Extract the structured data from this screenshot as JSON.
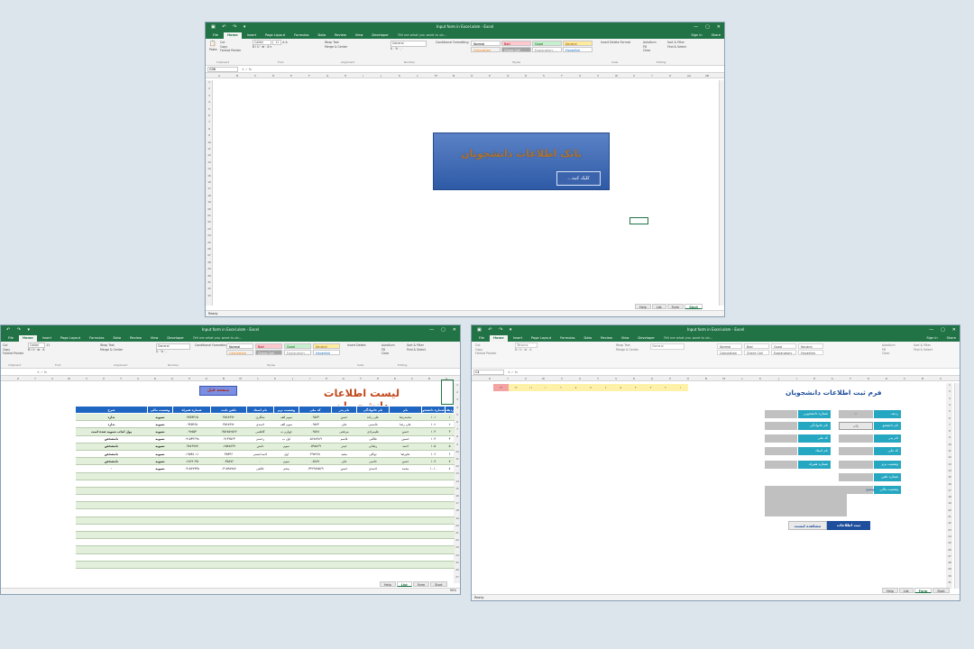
{
  "windows": {
    "main": {
      "title": "Input form in Excel.xlsm - Excel",
      "tabs": [
        "File",
        "Home",
        "Insert",
        "Page Layout",
        "Formulas",
        "Data",
        "Review",
        "View",
        "Developer"
      ],
      "tell": "Tell me what you want to do...",
      "signin": "Sign in",
      "share": "Share",
      "namebox": "G36",
      "sheets": [
        "Help",
        "List",
        "Form",
        "Start"
      ],
      "active_sheet": "Start",
      "status": "Ready"
    },
    "list": {
      "title": "Input form in Excel.xlsm - Excel",
      "sheets": [
        "Help",
        "List",
        "Form",
        "Start"
      ],
      "active_sheet": "List",
      "zoom": "90%"
    },
    "form": {
      "title": "Input form in Excel.xlsm - Excel",
      "sheets": [
        "Help",
        "List",
        "Form",
        "Start"
      ],
      "active_sheet": "Form",
      "status": "Ready",
      "namebox": "C4"
    }
  },
  "ribbon": {
    "clipboard": {
      "cut": "Cut",
      "copy": "Copy",
      "format_painter": "Format Painter",
      "paste": "Paste",
      "label": "Clipboard"
    },
    "font": {
      "name": "Calibri",
      "size": "11",
      "label": "Font"
    },
    "alignment": {
      "wrap": "Wrap Text",
      "merge": "Merge & Center",
      "label": "Alignment"
    },
    "number": {
      "format": "General",
      "label": "Number"
    },
    "styles": {
      "normal": "Normal",
      "bad": "Bad",
      "good": "Good",
      "neutral": "Neutral",
      "calculation": "Calculation",
      "check_cell": "Check Cell",
      "explanatory": "Explanatory ...",
      "hyperlink": "Hyperlink",
      "label": "Styles",
      "conditional": "Conditional Formatting",
      "format_table": "Format as Table"
    },
    "cells": {
      "insert": "Insert",
      "delete": "Delete",
      "format": "Format",
      "label": "Cells"
    },
    "editing": {
      "autosum": "AutoSum",
      "fill": "Fill",
      "clear": "Clear",
      "sort": "Sort & Filter",
      "find": "Find & Select",
      "label": "Editing"
    }
  },
  "splash": {
    "title": "بانک اطلاعات دانشجویان",
    "button": "کلیک کنید..."
  },
  "list_sheet": {
    "title": "لیست اطلاعات دانشجویان",
    "button": "صفحه قبل",
    "headers": [
      "ردیف",
      "شماره دانشجو",
      "نام",
      "نام خانوادگی",
      "نام پدر",
      "کد ملی",
      "وضعیت ترم",
      "نام استاد",
      "تلفن ثابت",
      "شماره همراه",
      "وضعیت مالی",
      "شرح"
    ],
    "rows": [
      [
        "۱",
        "۱۰۱",
        "محمدرضا",
        "علی زاده",
        "حسن",
        "۰۹۵۶۳",
        "سوم الف",
        "شکاری",
        "۴۵۶۸۹۹۲",
        "۰۹۳۵۴۳۶۵",
        "تسویه",
        "ندارد"
      ],
      [
        "۲",
        "۱۰۲",
        "علی رضا",
        "قاسمی",
        "علی",
        "۰۹۵۶۳",
        "سوم الف",
        "احمدی",
        "۴۵۶۸۹۹۲",
        "۰۹۳۵۴۶۵",
        "تسویه",
        "ندارد"
      ],
      [
        "۳",
        "۱۰۳",
        "حسن",
        "علیمرادی",
        "مرتضی",
        "۰۹۵۶۸",
        "چهارم ب",
        "کاظمی",
        "۰۹۵۶۸۵۲۵۶۷",
        "۰۹۲۵۵۴",
        "تسویه",
        "پول انتاب تسویه شده است"
      ],
      [
        "۴",
        "۱۰۴",
        "حسین",
        "طالبی",
        "قاسم",
        "۰۵۶۸۸۹۸۹",
        "اول ب",
        "رحمتی",
        "۰۹۱۴۳۵۶۴",
        "۰۹۱۵۴۳۶۹۸",
        "تسویه",
        "نامشخص"
      ],
      [
        "۵",
        "۱۰۵",
        "احمد",
        "رضائی",
        "حیدر",
        "۰۵۹۸۸۶۹",
        "سوم",
        "دانش",
        "۰۲۵۸۷۸۹۹",
        "۰۹۸۷۶۷۷۷",
        "تسویه",
        "نامشخص"
      ],
      [
        "۶",
        "۱۰۶",
        "علیرضا",
        "توکلی",
        "مجید",
        "۴۹۸۹۶۸",
        "اول",
        "احمدحسنی",
        "۴۵۴۳۶",
        "۰۱۹۵۴۸۰۱۱",
        "تسویه",
        "نامشخص"
      ],
      [
        "۷",
        "۱۰۹",
        "حسن",
        "حاتمی",
        "علی",
        "۰۵۶۸۷",
        "سوم",
        "۰",
        "۰۴۵۸۷۶",
        "۰۲۸۶۳۰۴۵",
        "تسویه",
        "نامشخص"
      ],
      [
        "۸",
        "۱۰۱۰",
        "محمد",
        "احمدی",
        "حسن",
        "۰۴۳۶۹۸۷۵۶۹",
        "پنجم",
        "خالقی",
        "۰۳۱۵۹۸۷۸۷",
        "۰۹۱۵۶۷۹۴۵",
        "تسویه",
        "۰"
      ]
    ]
  },
  "form_sheet": {
    "title": "فرم ثبت اطلاعات دانشجویان",
    "numbers": [
      "۱",
      "۲",
      "۳",
      "۴",
      "۵",
      "۶",
      "۷",
      "۸",
      "۹",
      "۱۰",
      "۱۱",
      "۱۲",
      "۱۳"
    ],
    "right_labels": [
      "ردیف",
      "نام دانشجو",
      "نام پدر",
      "کد ملی",
      "وضعیت ترم",
      "شماره تلفن",
      "وضعیت مالی",
      "توضیح"
    ],
    "left_labels": [
      "شماره دانشجویی",
      "نام خانوادگی",
      "کد ملی",
      "نام استاد",
      "شماره همراه"
    ],
    "row_value": "۱۱",
    "name_value": "یگانه",
    "btn_save": "ثبت اطلاعات",
    "btn_view": "مشاهده لیست"
  }
}
